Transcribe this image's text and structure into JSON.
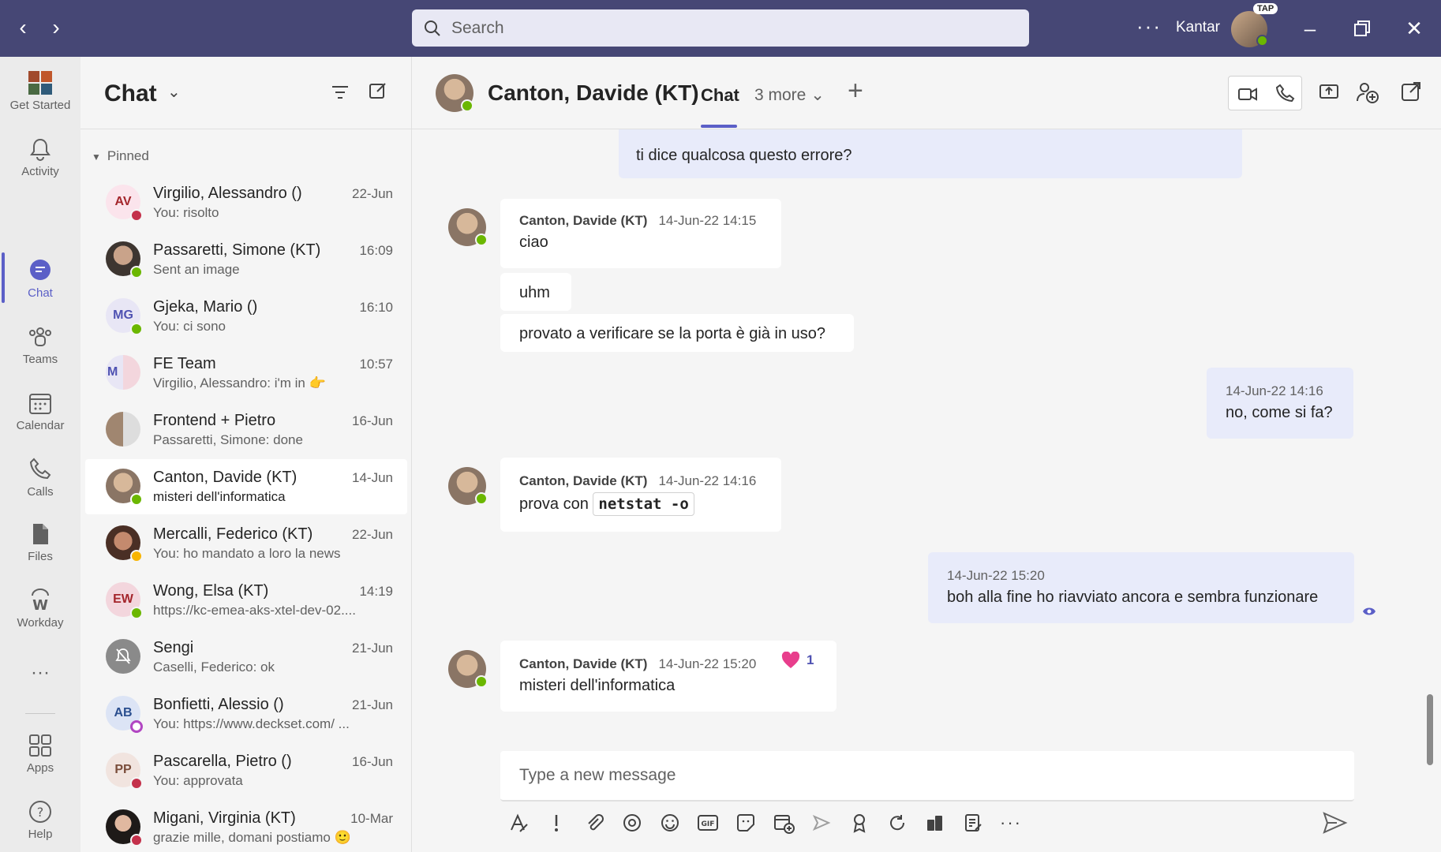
{
  "titlebar": {
    "search_placeholder": "Search",
    "more": "···",
    "org": "Kantar",
    "avatar_badge": "TAP"
  },
  "rail": {
    "items": [
      {
        "label": "Get Started",
        "icon": "get-started-icon"
      },
      {
        "label": "Activity",
        "icon": "bell-icon"
      },
      {
        "label": "Chat",
        "icon": "chat-icon"
      },
      {
        "label": "Teams",
        "icon": "teams-icon"
      },
      {
        "label": "Calendar",
        "icon": "calendar-icon"
      },
      {
        "label": "Calls",
        "icon": "phone-icon"
      },
      {
        "label": "Files",
        "icon": "file-icon"
      },
      {
        "label": "Workday",
        "icon": "workday-icon"
      },
      {
        "label": "···",
        "icon": "more-icon"
      },
      {
        "label": "Apps",
        "icon": "apps-icon"
      },
      {
        "label": "Help",
        "icon": "help-icon"
      }
    ]
  },
  "chatlist": {
    "title": "Chat",
    "pinned_label": "Pinned",
    "items": [
      {
        "name": "Virgilio, Alessandro ()",
        "preview": "You: risolto",
        "time": "22-Jun",
        "initials": "AV",
        "presence": "#c4314b"
      },
      {
        "name": "Passaretti, Simone (KT)",
        "preview": "Sent an image",
        "time": "16:09",
        "initials": "",
        "presence": "#6bb700"
      },
      {
        "name": "Gjeka, Mario ()",
        "preview": "You: ci sono",
        "time": "16:10",
        "initials": "MG",
        "presence": "#6bb700"
      },
      {
        "name": "FE Team",
        "preview": "Virgilio, Alessandro: i'm in 👉",
        "time": "10:57",
        "initials": "M",
        "presence": ""
      },
      {
        "name": "Frontend + Pietro",
        "preview": "Passaretti, Simone: done",
        "time": "16-Jun",
        "initials": "",
        "presence": ""
      },
      {
        "name": "Canton, Davide (KT)",
        "preview": "misteri dell'informatica",
        "time": "14-Jun",
        "initials": "",
        "presence": "#6bb700"
      },
      {
        "name": "Mercalli, Federico (KT)",
        "preview": "You: ho mandato a loro la news",
        "time": "22-Jun",
        "initials": "",
        "presence": "#f8b400"
      },
      {
        "name": "Wong, Elsa (KT)",
        "preview": "https://kc-emea-aks-xtel-dev-02....",
        "time": "14:19",
        "initials": "EW",
        "presence": "#6bb700"
      },
      {
        "name": "Sengi",
        "preview": "Caselli, Federico: ok",
        "time": "21-Jun",
        "initials": "",
        "presence": ""
      },
      {
        "name": "Bonfietti, Alessio ()",
        "preview": "You: https://www.deckset.com/ ...",
        "time": "21-Jun",
        "initials": "AB",
        "presence": "#b146c2"
      },
      {
        "name": "Pascarella, Pietro ()",
        "preview": "You: approvata",
        "time": "16-Jun",
        "initials": "PP",
        "presence": "#c4314b"
      },
      {
        "name": "Migani, Virginia (KT)",
        "preview": "grazie mille, domani postiamo 🙂",
        "time": "10-Mar",
        "initials": "",
        "presence": "#c4314b"
      }
    ]
  },
  "main": {
    "contact_name": "Canton, Davide (KT)",
    "tab_chat": "Chat",
    "tab_more": "3 more ⌄",
    "plus": "+",
    "messages": [
      {
        "id": "m0",
        "text": "ti dice qualcosa questo errore?"
      },
      {
        "id": "m1",
        "sender": "Canton, Davide (KT)",
        "time": "14-Jun-22 14:15",
        "text": "ciao"
      },
      {
        "id": "m2",
        "text": "uhm"
      },
      {
        "id": "m3",
        "text": "provato a verificare se la porta è già in uso?"
      },
      {
        "id": "m4",
        "time": "14-Jun-22 14:16",
        "text": "no, come si fa?"
      },
      {
        "id": "m5",
        "sender": "Canton, Davide (KT)",
        "time": "14-Jun-22 14:16",
        "text": "prova con",
        "code": "netstat -o"
      },
      {
        "id": "m6",
        "time": "14-Jun-22 15:20",
        "text": "boh alla fine ho riavviato ancora e sembra funzionare"
      },
      {
        "id": "m7",
        "sender": "Canton, Davide (KT)",
        "time": "14-Jun-22 15:20",
        "text": "misteri dell'informatica",
        "reaction": "1"
      }
    ],
    "composer_placeholder": "Type a new message"
  }
}
